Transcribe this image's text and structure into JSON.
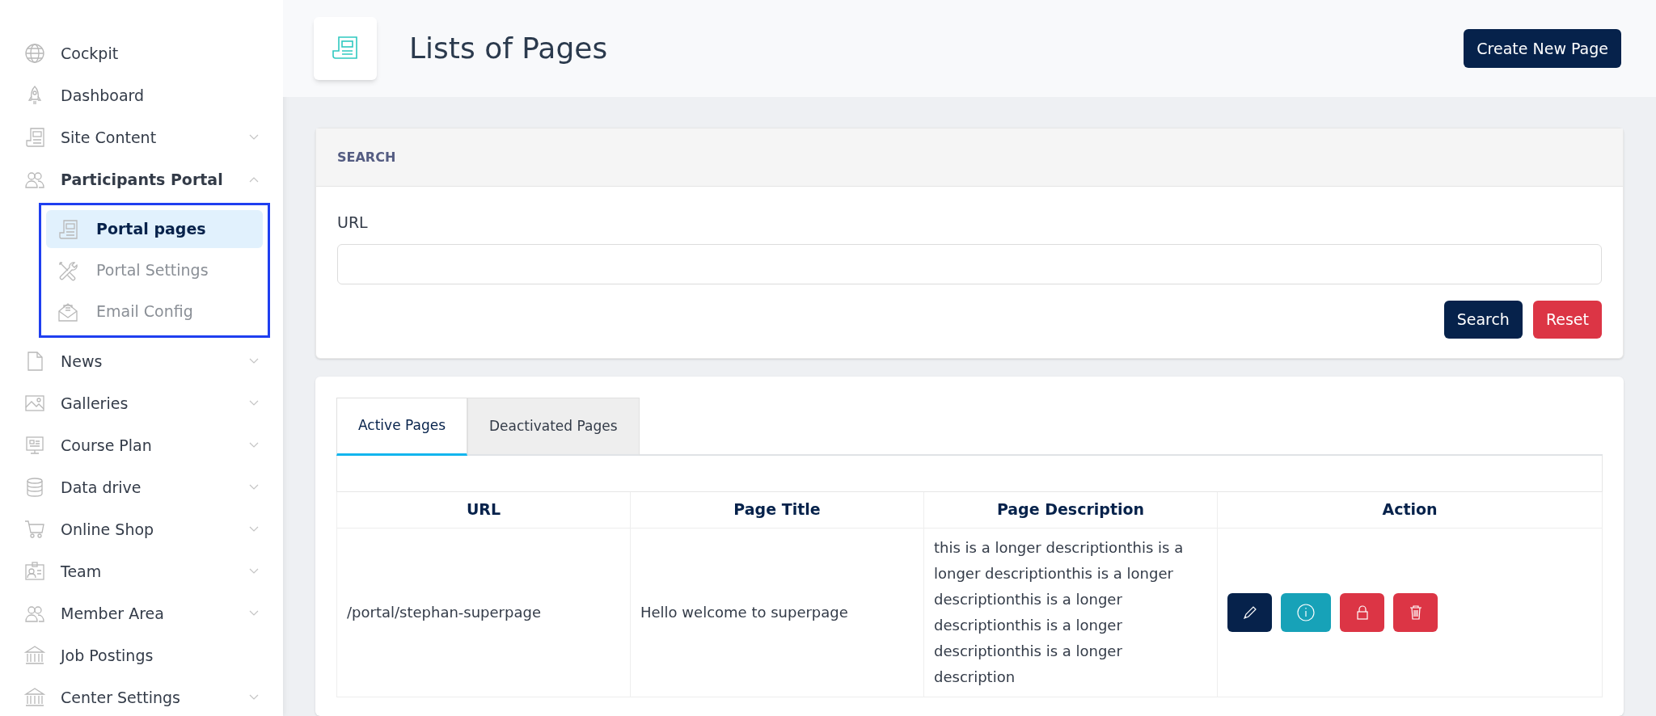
{
  "sidebar": {
    "items": [
      {
        "label": "Cockpit",
        "selected": false
      },
      {
        "label": "Dashboard",
        "selected": false
      },
      {
        "label": "Site Content",
        "selected": false,
        "expanded": false
      },
      {
        "label": "Participants Portal",
        "selected": false,
        "expanded": true,
        "children": [
          {
            "label": "Portal pages",
            "selected": true
          },
          {
            "label": "Portal Settings",
            "selected": false
          },
          {
            "label": "Email Config",
            "selected": false
          }
        ]
      },
      {
        "label": "News",
        "selected": false,
        "expanded": false
      },
      {
        "label": "Galleries",
        "selected": false,
        "expanded": false
      },
      {
        "label": "Course Plan",
        "selected": false,
        "expanded": false
      },
      {
        "label": "Data drive",
        "selected": false,
        "expanded": false
      },
      {
        "label": "Online Shop",
        "selected": false,
        "expanded": false
      },
      {
        "label": "Team",
        "selected": false,
        "expanded": false
      },
      {
        "label": "Member Area",
        "selected": false,
        "expanded": false
      },
      {
        "label": "Job Postings",
        "selected": false
      },
      {
        "label": "Center Settings",
        "selected": false,
        "expanded": false
      }
    ]
  },
  "header": {
    "title": "Lists of Pages",
    "button": "Create New Page"
  },
  "search": {
    "heading": "SEARCH",
    "field_label": "URL",
    "buttons": [
      "Search",
      "Reset"
    ]
  },
  "tabs": [
    {
      "label": "Active Pages",
      "selected": true
    },
    {
      "label": "Deactivated Pages",
      "selected": false
    }
  ],
  "table": {
    "columns": [
      "URL",
      "Page Title",
      "Page Description",
      "Action"
    ],
    "rows": [
      {
        "url": "/portal/stephan-superpage",
        "title": "Hello welcome to superpage",
        "description": "this is a longer descriptionthis is a longer descriptionthis is a longer descriptionthis is a longer descriptionthis is a longer descriptionthis is a longer description"
      }
    ]
  }
}
